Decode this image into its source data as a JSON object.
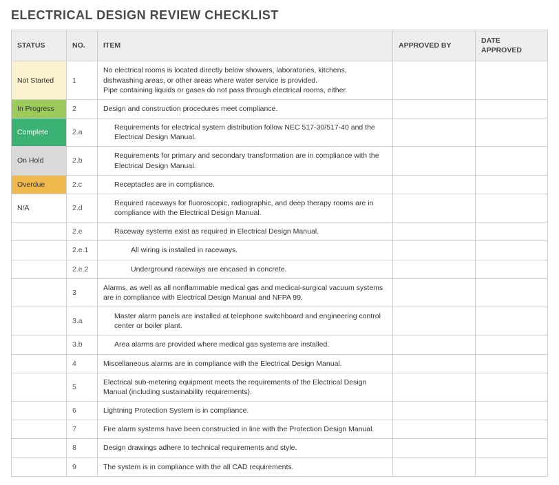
{
  "title": "ELECTRICAL DESIGN REVIEW CHECKLIST",
  "columns": {
    "status": "STATUS",
    "no": "NO.",
    "item": "ITEM",
    "approved_by": "APPROVED BY",
    "date_approved": "DATE APPROVED"
  },
  "status_styles": {
    "Not Started": "st-not-started",
    "In Progress": "st-in-progress",
    "Complete": "st-complete",
    "On Hold": "st-on-hold",
    "Overdue": "st-overdue",
    "N/A": "st-na",
    "": "st-blank"
  },
  "rows": [
    {
      "status": "Not Started",
      "no": "1",
      "indent": 0,
      "item": "No electrical rooms is located directly below showers, laboratories, kitchens, dishwashing areas, or other areas where water service is provided.\nPipe containing liquids or gases do not pass through electrical rooms, either.",
      "approved_by": "",
      "date_approved": ""
    },
    {
      "status": "In Progress",
      "no": "2",
      "indent": 0,
      "item": "Design and construction procedures meet compliance.",
      "approved_by": "",
      "date_approved": ""
    },
    {
      "status": "Complete",
      "no": "2.a",
      "indent": 1,
      "item": "Requirements for electrical system distribution follow NEC 517-30/517-40 and the Electrical Design Manual.",
      "approved_by": "",
      "date_approved": ""
    },
    {
      "status": "On Hold",
      "no": "2.b",
      "indent": 1,
      "item": "Requirements for primary and secondary transformation are in compliance with the Electrical Design Manual.",
      "approved_by": "",
      "date_approved": ""
    },
    {
      "status": "Overdue",
      "no": "2.c",
      "indent": 1,
      "item": "Receptacles are in compliance.",
      "approved_by": "",
      "date_approved": ""
    },
    {
      "status": "N/A",
      "no": "2.d",
      "indent": 1,
      "item": "Required raceways for fluoroscopic, radiographic, and deep therapy rooms are in compliance with the Electrical Design Manual.",
      "approved_by": "",
      "date_approved": ""
    },
    {
      "status": "",
      "no": "2.e",
      "indent": 1,
      "item": "Raceway systems exist as required in Electrical Design Manual.",
      "approved_by": "",
      "date_approved": ""
    },
    {
      "status": "",
      "no": "2.e.1",
      "indent": 2,
      "item": "All wiring is installed in raceways.",
      "approved_by": "",
      "date_approved": ""
    },
    {
      "status": "",
      "no": "2.e.2",
      "indent": 2,
      "item": "Underground raceways are encased in concrete.",
      "approved_by": "",
      "date_approved": ""
    },
    {
      "status": "",
      "no": "3",
      "indent": 0,
      "item": "Alarms, as well as all nonflammable medical gas and medical-surgical vacuum systems are in compliance with Electrical Design Manual and NFPA 99.",
      "approved_by": "",
      "date_approved": ""
    },
    {
      "status": "",
      "no": "3.a",
      "indent": 1,
      "item": "Master alarm panels are installed at telephone switchboard and engineering control center or boiler plant.",
      "approved_by": "",
      "date_approved": ""
    },
    {
      "status": "",
      "no": "3.b",
      "indent": 1,
      "item": "Area alarms are provided where medical gas systems are installed.",
      "approved_by": "",
      "date_approved": ""
    },
    {
      "status": "",
      "no": "4",
      "indent": 0,
      "item": "Miscellaneous alarms are in compliance with the Electrical Design Manual.",
      "approved_by": "",
      "date_approved": ""
    },
    {
      "status": "",
      "no": "5",
      "indent": 0,
      "item": "Electrical sub-metering equipment meets the requirements of the Electrical Design Manual (including sustainability requirements).",
      "approved_by": "",
      "date_approved": ""
    },
    {
      "status": "",
      "no": "6",
      "indent": 0,
      "item": "Lightning Protection System is in compliance.",
      "approved_by": "",
      "date_approved": ""
    },
    {
      "status": "",
      "no": "7",
      "indent": 0,
      "item": "Fire alarm systems have been constructed in line with the Protection Design Manual.",
      "approved_by": "",
      "date_approved": ""
    },
    {
      "status": "",
      "no": "8",
      "indent": 0,
      "item": "Design drawings adhere to technical requirements and style.",
      "approved_by": "",
      "date_approved": ""
    },
    {
      "status": "",
      "no": "9",
      "indent": 0,
      "item": "The system is in compliance with the all CAD requirements.",
      "approved_by": "",
      "date_approved": ""
    }
  ]
}
